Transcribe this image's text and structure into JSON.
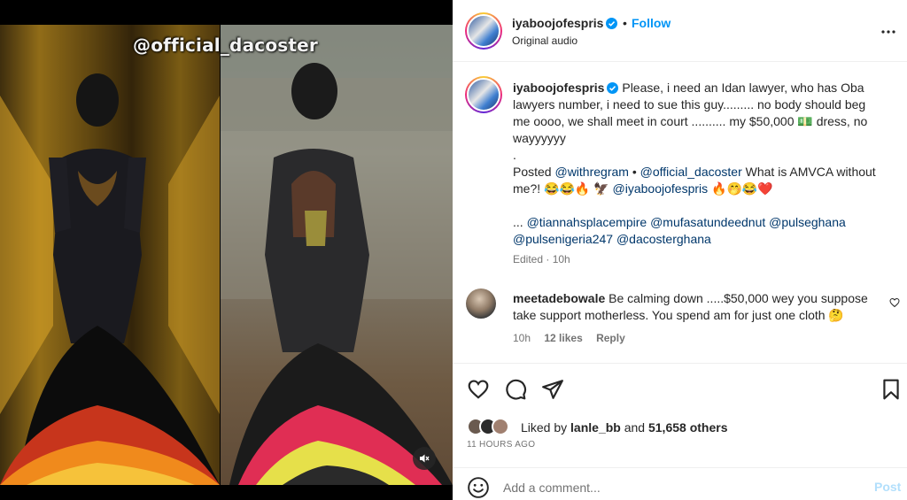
{
  "media": {
    "watermark": "@official_dacoster"
  },
  "header": {
    "username": "iyaboojofespris",
    "separator": "•",
    "follow_label": "Follow",
    "audio": "Original audio"
  },
  "caption": {
    "username": "iyaboojofespris",
    "line1": "Please, i need an Idan lawyer, who has Oba lawyers number, i need to sue this guy......... no body should beg me oooo, we shall meet in court .......... my $50,000 💵 dress, no wayyyyyy",
    "dot": ".",
    "posted_prefix": "Posted",
    "posted_link1": "@withregram",
    "posted_sep": "•",
    "posted_link2": "@official_dacoster",
    "posted_text": "What is AMVCA without me?! 😂😂🔥 🦅",
    "posted_link3": "@iyaboojofespris",
    "posted_emojis": "🔥🤭😂❤️",
    "tags_prefix": "...",
    "tag1": "@tiannahsplacempire",
    "tag2": "@mufasatundeednut",
    "tag3": "@pulseghana",
    "tag4": "@pulsenigeria247",
    "tag5": "@dacosterghana",
    "meta": "Edited · 10h"
  },
  "comment": {
    "username": "meetadebowale",
    "text": "Be calming down .....$50,000 wey you suppose take support motherless. You spend am for just one cloth 🤔",
    "time": "10h",
    "likes": "12 likes",
    "reply": "Reply"
  },
  "actions": {
    "liked_prefix": "Liked by",
    "liked_user": "lanle_bb",
    "liked_and": "and",
    "liked_others": "51,658 others",
    "time_ago": "11 HOURS AGO"
  },
  "add_comment": {
    "placeholder": "Add a comment...",
    "post_label": "Post"
  },
  "colors": {
    "accent": "#0095f6",
    "link": "#00376b",
    "muted": "#737373",
    "post_disabled": "#b2dffc"
  }
}
